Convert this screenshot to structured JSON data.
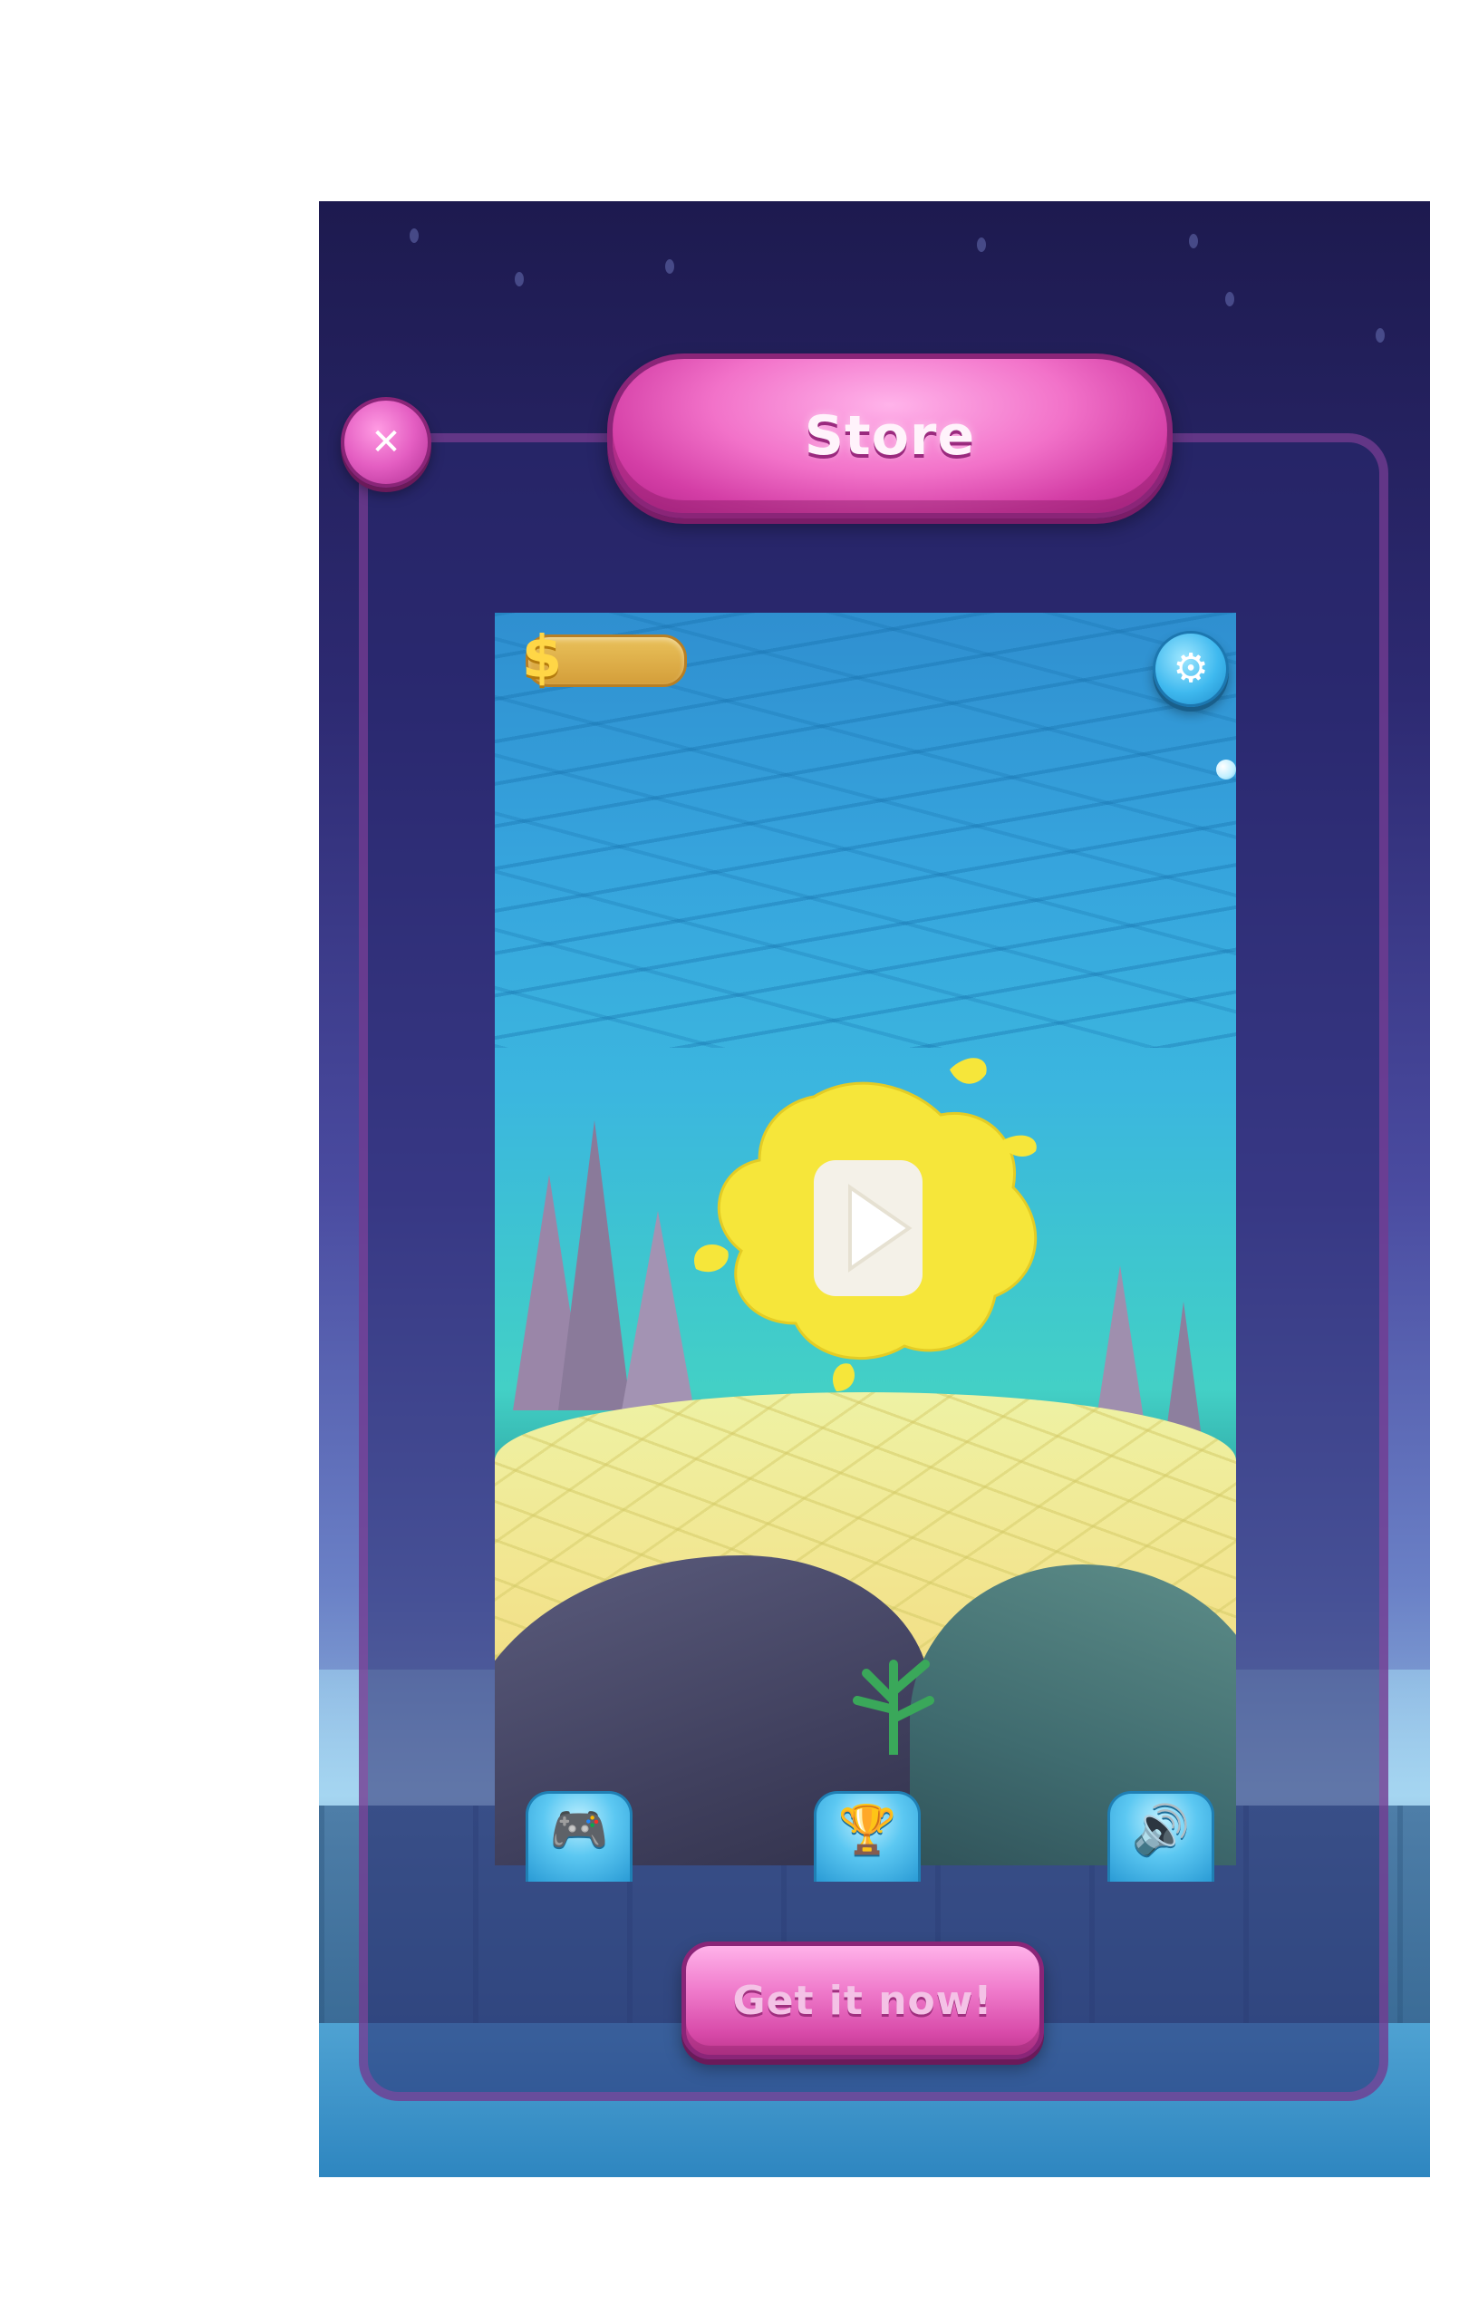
{
  "store": {
    "title": "Store",
    "close_icon": "close-icon",
    "cta_label": "Get it now!"
  },
  "preview": {
    "coin_symbol": "$",
    "coin_icon": "dollar-coin-icon",
    "settings_icon": "gear-icon",
    "play_icon": "play-icon",
    "bottom_buttons": [
      {
        "icon": "gamepad-icon",
        "glyph": "🎮"
      },
      {
        "icon": "trophy-icon",
        "glyph": "🏆"
      },
      {
        "icon": "speaker-icon",
        "glyph": "🔊"
      }
    ]
  },
  "colors": {
    "pink_button": "#e45ec2",
    "blue_button": "#3fb9ef",
    "play_yellow": "#f6e63a",
    "scene_top": "#1d1a4f"
  }
}
